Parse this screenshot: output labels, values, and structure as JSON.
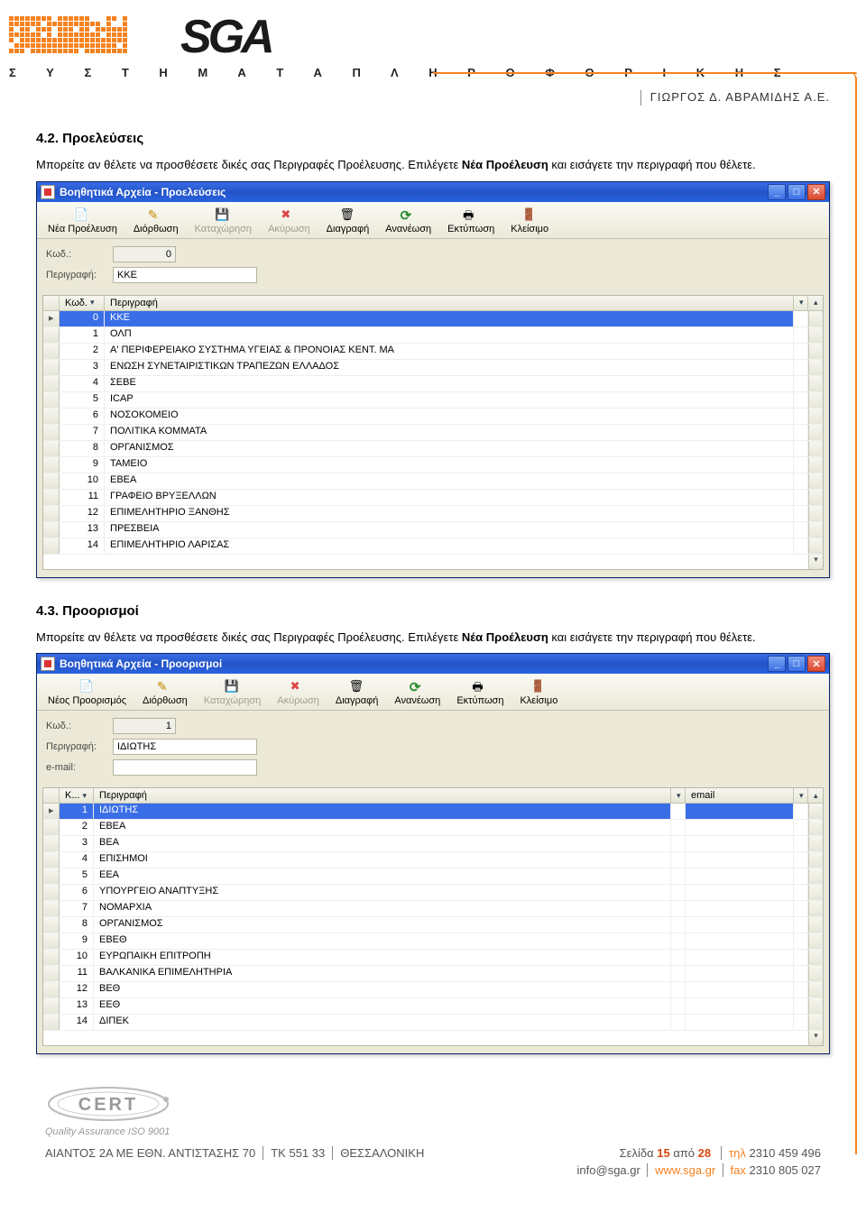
{
  "header": {
    "brand_letters": "SGA",
    "subtitle": "Σ Υ Σ Τ Η Μ Α Τ Α   Π Λ Η Ρ Ο Φ Ο Ρ Ι Κ Η Σ",
    "company": "ΓΙΩΡΓΟΣ Δ. ΑΒΡΑΜΙΔΗΣ Α.Ε."
  },
  "section1": {
    "title": "4.2. Προελεύσεις",
    "body_pre": "Μπορείτε αν θέλετε να προσθέσετε δικές σας Περιγραφές Προέλευσης. Επιλέγετε ",
    "body_bold": "Νέα Προέλευση",
    "body_post": " και εισάγετε την περιγραφή που θέλετε."
  },
  "win1": {
    "title": "Βοηθητικά Αρχεία - Προελεύσεις",
    "toolbar": [
      {
        "label": "Νέα Προέλευση",
        "icon": "ico-new",
        "disabled": false
      },
      {
        "label": "Διόρθωση",
        "icon": "ico-edit",
        "disabled": false
      },
      {
        "label": "Καταχώρηση",
        "icon": "ico-save",
        "disabled": true
      },
      {
        "label": "Ακύρωση",
        "icon": "ico-cancel",
        "disabled": true
      },
      {
        "label": "Διαγραφή",
        "icon": "ico-del",
        "disabled": false
      },
      {
        "label": "Ανανέωση",
        "icon": "ico-refresh",
        "disabled": false
      },
      {
        "label": "Εκτύπωση",
        "icon": "ico-print",
        "disabled": false
      },
      {
        "label": "Κλείσιμο",
        "icon": "ico-close",
        "disabled": false
      }
    ],
    "form": {
      "kod_label": "Κωδ.:",
      "kod_value": "0",
      "desc_label": "Περιγραφή:",
      "desc_value": "ΚΚΕ"
    },
    "columns": {
      "kod": "Κωδ.",
      "desc": "Περιγραφή"
    },
    "rows": [
      {
        "kod": "0",
        "desc": "ΚΚΕ",
        "sel": true,
        "cursor": true
      },
      {
        "kod": "1",
        "desc": "ΟΛΠ"
      },
      {
        "kod": "2",
        "desc": "Α' ΠΕΡΙΦΕΡΕΙΑΚΟ ΣΥΣΤΗΜΑ ΥΓΕΙΑΣ & ΠΡΟΝΟΙΑΣ ΚΕΝΤ. ΜΑ"
      },
      {
        "kod": "3",
        "desc": "ΕΝΩΣΗ ΣΥΝΕΤΑΙΡΙΣΤΙΚΩΝ ΤΡΑΠΕΖΩΝ ΕΛΛΑΔΟΣ"
      },
      {
        "kod": "4",
        "desc": "ΣΕΒΕ"
      },
      {
        "kod": "5",
        "desc": "ICAP"
      },
      {
        "kod": "6",
        "desc": "ΝΟΣΟΚΟΜΕΙΟ"
      },
      {
        "kod": "7",
        "desc": "ΠΟΛΙΤΙΚΑ ΚΟΜΜΑΤΑ"
      },
      {
        "kod": "8",
        "desc": "ΟΡΓΑΝΙΣΜΟΣ"
      },
      {
        "kod": "9",
        "desc": "ΤΑΜΕΙΟ"
      },
      {
        "kod": "10",
        "desc": "ΕΒΕΑ"
      },
      {
        "kod": "11",
        "desc": "ΓΡΑΦΕΙΟ ΒΡΥΞΕΛΛΩΝ"
      },
      {
        "kod": "12",
        "desc": "ΕΠΙΜΕΛΗΤΗΡΙΟ ΞΑΝΘΗΣ"
      },
      {
        "kod": "13",
        "desc": "ΠΡΕΣΒΕΙΑ"
      },
      {
        "kod": "14",
        "desc": "ΕΠΙΜΕΛΗΤΗΡΙΟ ΛΑΡΙΣΑΣ"
      }
    ]
  },
  "section2": {
    "title": "4.3. Προορισμοί",
    "body_pre": "Μπορείτε αν θέλετε να προσθέσετε δικές σας Περιγραφές Προέλευσης. Επιλέγετε ",
    "body_bold": "Νέα Προέλευση",
    "body_post": " και εισάγετε την περιγραφή που θέλετε."
  },
  "win2": {
    "title": "Βοηθητικά Αρχεία - Προορισμοί",
    "toolbar": [
      {
        "label": "Νέος Προορισμός",
        "icon": "ico-new",
        "disabled": false
      },
      {
        "label": "Διόρθωση",
        "icon": "ico-edit",
        "disabled": false
      },
      {
        "label": "Καταχώρηση",
        "icon": "ico-save",
        "disabled": true
      },
      {
        "label": "Ακύρωση",
        "icon": "ico-cancel",
        "disabled": true
      },
      {
        "label": "Διαγραφή",
        "icon": "ico-del",
        "disabled": false
      },
      {
        "label": "Ανανέωση",
        "icon": "ico-refresh",
        "disabled": false
      },
      {
        "label": "Εκτύπωση",
        "icon": "ico-print",
        "disabled": false
      },
      {
        "label": "Κλείσιμο",
        "icon": "ico-close",
        "disabled": false
      }
    ],
    "form": {
      "kod_label": "Κωδ.:",
      "kod_value": "1",
      "desc_label": "Περιγραφή:",
      "desc_value": "ΙΔΙΩΤΗΣ",
      "email_label": "e-mail:",
      "email_value": ""
    },
    "columns": {
      "kod": "Κ...",
      "desc": "Περιγραφή",
      "email": "email"
    },
    "rows": [
      {
        "kod": "1",
        "desc": "ΙΔΙΩΤΗΣ",
        "sel": true,
        "cursor": true,
        "email": ""
      },
      {
        "kod": "2",
        "desc": "ΕΒΕΑ",
        "email": ""
      },
      {
        "kod": "3",
        "desc": "ΒΕΑ",
        "email": ""
      },
      {
        "kod": "4",
        "desc": "ΕΠΙΣΗΜΟΙ",
        "email": ""
      },
      {
        "kod": "5",
        "desc": "ΕΕΑ",
        "email": ""
      },
      {
        "kod": "6",
        "desc": "ΥΠΟΥΡΓΕΙΟ ΑΝΑΠΤΥΞΗΣ",
        "email": ""
      },
      {
        "kod": "7",
        "desc": "ΝΟΜΑΡΧΙΑ",
        "email": ""
      },
      {
        "kod": "8",
        "desc": "ΟΡΓΑΝΙΣΜΟΣ",
        "email": ""
      },
      {
        "kod": "9",
        "desc": "ΕΒΕΘ",
        "email": ""
      },
      {
        "kod": "10",
        "desc": "ΕΥΡΩΠΑΙΚΗ ΕΠΙΤΡΟΠΗ",
        "email": ""
      },
      {
        "kod": "11",
        "desc": "ΒΑΛΚΑΝΙΚΑ ΕΠΙΜΕΛΗΤΗΡΙΑ",
        "email": ""
      },
      {
        "kod": "12",
        "desc": "ΒΕΘ",
        "email": ""
      },
      {
        "kod": "13",
        "desc": "ΕΕΘ",
        "email": ""
      },
      {
        "kod": "14",
        "desc": "ΔΙΠΕΚ",
        "email": ""
      }
    ]
  },
  "footer": {
    "cert_label": "CERT",
    "cert_sub": "Quality Assurance ISO 9001",
    "address": "ΑΙΑΝΤΟΣ 2Α ΜΕ ΕΘΝ. ΑΝΤΙΣΤΑΣΗΣ 70",
    "tk": "ΤΚ 551 33",
    "city": "ΘΕΣΣΑΛΟΝΙΚΗ",
    "page_label_pre": "Σελίδα ",
    "page_cur": "15",
    "page_mid": " από ",
    "page_total": "28",
    "tel_label": "τηλ",
    "tel": "2310 459 496",
    "email": "info@sga.gr",
    "web": "www.sga.gr",
    "fax_label": "fax",
    "fax": "2310 805 027"
  },
  "glyphs": {
    "min": "_",
    "max": "□",
    "close": "✕",
    "arrow": "▸",
    "drop": "▾",
    "up": "▴",
    "down": "▾"
  }
}
